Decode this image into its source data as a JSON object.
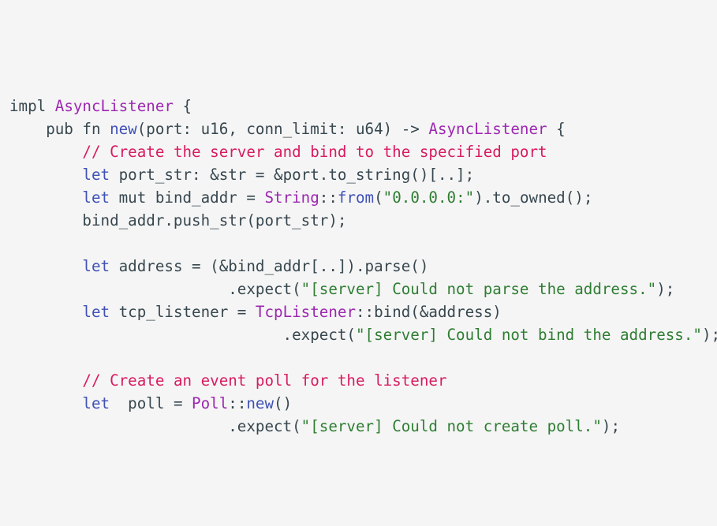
{
  "code": {
    "language": "rust",
    "lines": [
      [
        {
          "t": "impl ",
          "k": "plain"
        },
        {
          "t": "AsyncListener",
          "k": "type"
        },
        {
          "t": " {",
          "k": "plain"
        }
      ],
      [
        {
          "t": "    pub fn ",
          "k": "plain"
        },
        {
          "t": "new",
          "k": "fn"
        },
        {
          "t": "(port: u16, conn_limit: u64) -> ",
          "k": "plain"
        },
        {
          "t": "AsyncListener",
          "k": "type"
        },
        {
          "t": " {",
          "k": "plain"
        }
      ],
      [
        {
          "t": "        ",
          "k": "plain"
        },
        {
          "t": "// Create the server and bind to the specified port",
          "k": "comment"
        }
      ],
      [
        {
          "t": "        ",
          "k": "plain"
        },
        {
          "t": "let",
          "k": "keyword"
        },
        {
          "t": " port_str: &str = &port.to_string()[..];",
          "k": "plain"
        }
      ],
      [
        {
          "t": "        ",
          "k": "plain"
        },
        {
          "t": "let",
          "k": "keyword"
        },
        {
          "t": " mut bind_addr = ",
          "k": "plain"
        },
        {
          "t": "String",
          "k": "type"
        },
        {
          "t": "::",
          "k": "plain"
        },
        {
          "t": "from",
          "k": "fn"
        },
        {
          "t": "(",
          "k": "plain"
        },
        {
          "t": "\"0.0.0.0:\"",
          "k": "string"
        },
        {
          "t": ").to_owned();",
          "k": "plain"
        }
      ],
      [
        {
          "t": "        bind_addr.push_str(port_str);",
          "k": "plain"
        }
      ],
      [],
      [
        {
          "t": "        ",
          "k": "plain"
        },
        {
          "t": "let",
          "k": "keyword"
        },
        {
          "t": " address = (&bind_addr[..]).parse()",
          "k": "plain"
        }
      ],
      [
        {
          "t": "                        .expect(",
          "k": "plain"
        },
        {
          "t": "\"[server] Could not parse the address.\"",
          "k": "string"
        },
        {
          "t": ");",
          "k": "plain"
        }
      ],
      [
        {
          "t": "        ",
          "k": "plain"
        },
        {
          "t": "let",
          "k": "keyword"
        },
        {
          "t": " tcp_listener = ",
          "k": "plain"
        },
        {
          "t": "TcpListener",
          "k": "type"
        },
        {
          "t": "::bind(&address)",
          "k": "plain"
        }
      ],
      [
        {
          "t": "                              .expect(",
          "k": "plain"
        },
        {
          "t": "\"[server] Could not bind the address.\"",
          "k": "string"
        },
        {
          "t": ");",
          "k": "plain"
        }
      ],
      [],
      [
        {
          "t": "        ",
          "k": "plain"
        },
        {
          "t": "// Create an event poll for the listener",
          "k": "comment"
        }
      ],
      [
        {
          "t": "        ",
          "k": "plain"
        },
        {
          "t": "let",
          "k": "keyword"
        },
        {
          "t": "  poll = ",
          "k": "plain"
        },
        {
          "t": "Poll",
          "k": "type"
        },
        {
          "t": "::",
          "k": "plain"
        },
        {
          "t": "new",
          "k": "fn"
        },
        {
          "t": "()",
          "k": "plain"
        }
      ],
      [
        {
          "t": "                        .expect(",
          "k": "plain"
        },
        {
          "t": "\"[server] Could not create poll.\"",
          "k": "string"
        },
        {
          "t": ");",
          "k": "plain"
        }
      ]
    ]
  },
  "colors": {
    "background": "#f5f5f5",
    "plain": "#37474f",
    "keyword": "#3f51b5",
    "type": "#9c27b0",
    "string": "#2e7d32",
    "comment": "#d81b60"
  }
}
